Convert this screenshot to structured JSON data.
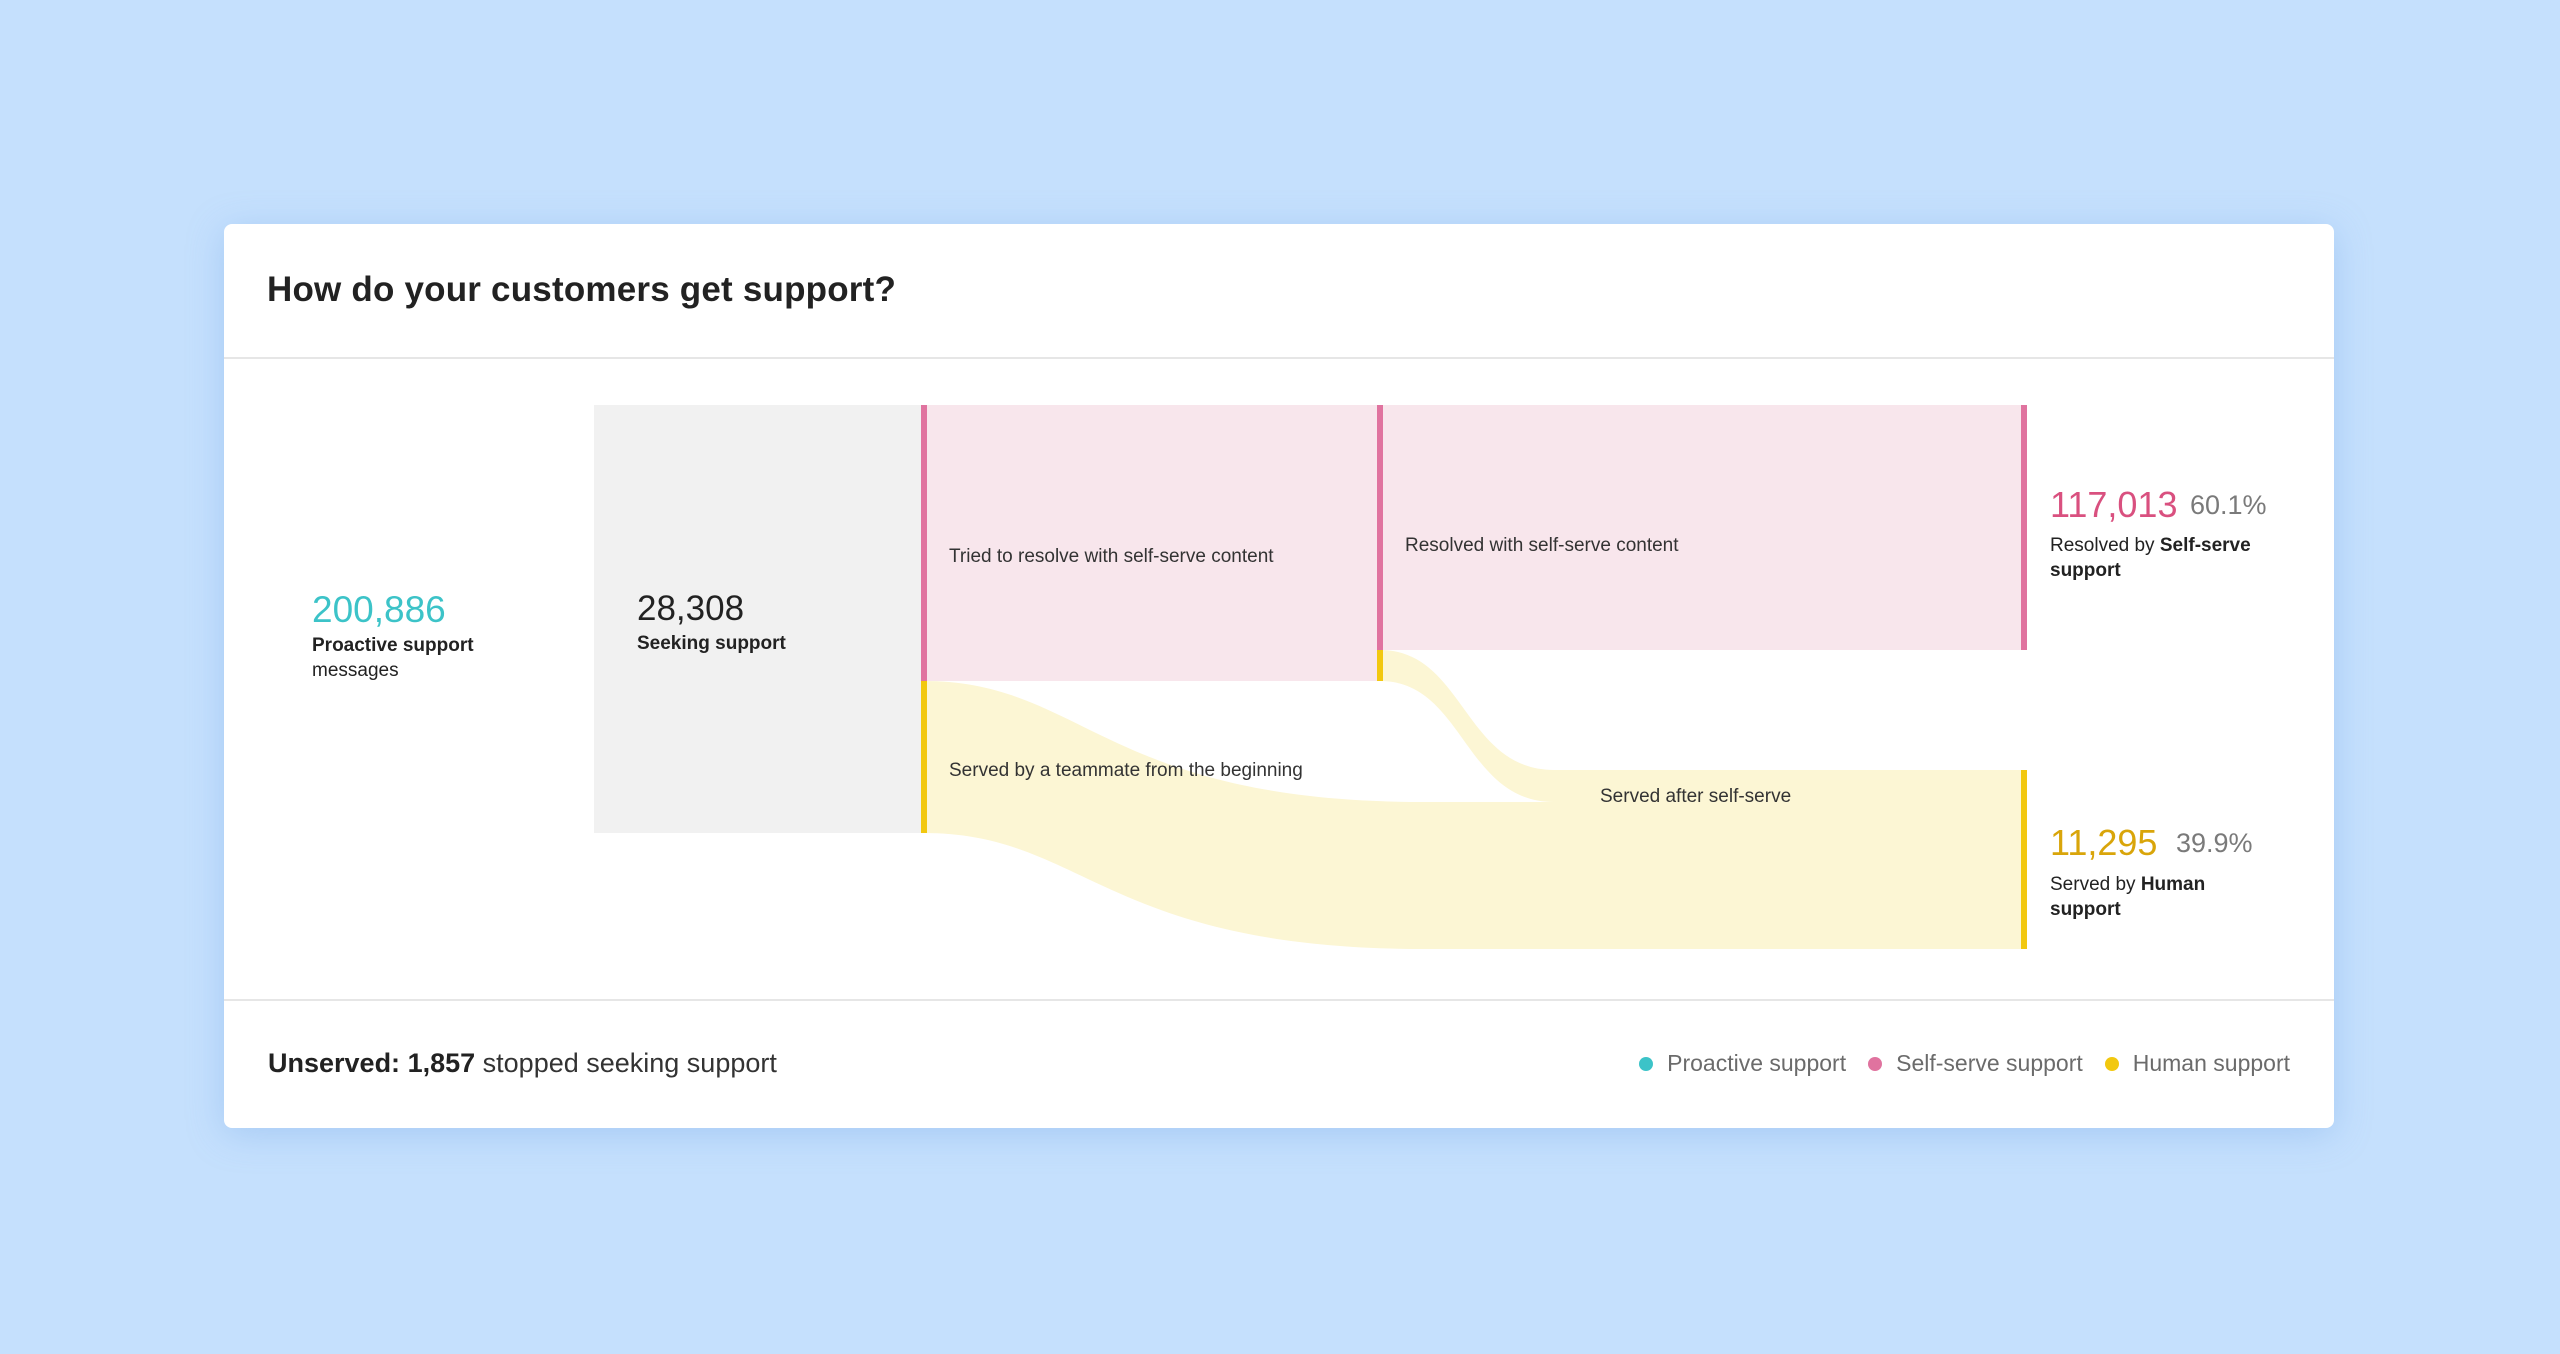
{
  "card": {
    "title": "How do your customers get support?"
  },
  "stats": {
    "proactive": {
      "value": "200,886",
      "label_bold": "Proactive support",
      "label_rest": "messages"
    },
    "seeking": {
      "value": "28,308",
      "label_bold": "Seeking support"
    },
    "selfserve_result": {
      "value": "117,013",
      "percent": "60.1%",
      "label_prefix": "Resolved by",
      "label_bold_1": "Self-serve",
      "label_bold_2": "support"
    },
    "human_result": {
      "value": "11,295",
      "percent": "39.9%",
      "label_prefix": "Served by",
      "label_bold_1": "Human",
      "label_bold_2": "support"
    }
  },
  "nodes": {
    "tried_selfserve": "Tried to resolve with self-serve content",
    "resolved_selfserve": "Resolved with self-serve content",
    "teammate_beginning": "Served by a teammate from the beginning",
    "after_selfserve": "Served after self-serve"
  },
  "footer": {
    "unserved_label": "Unserved:",
    "unserved_value": "1,857",
    "unserved_text": "stopped seeking support"
  },
  "legend": [
    {
      "label": "Proactive support",
      "color": "#3cc3c8"
    },
    {
      "label": "Self-serve support",
      "color": "#e0739f"
    },
    {
      "label": "Human support",
      "color": "#f2c80f"
    }
  ],
  "colors": {
    "proactive": "#3cc3c8",
    "selfserve": "#e0739f",
    "selfserve_text": "#d9507f",
    "selfserve_fill": "#f8e6ec",
    "human": "#f2c80f",
    "human_text": "#d9a50a",
    "human_fill": "#fcf6d4",
    "neutral_fill": "#f1f1f1"
  }
}
